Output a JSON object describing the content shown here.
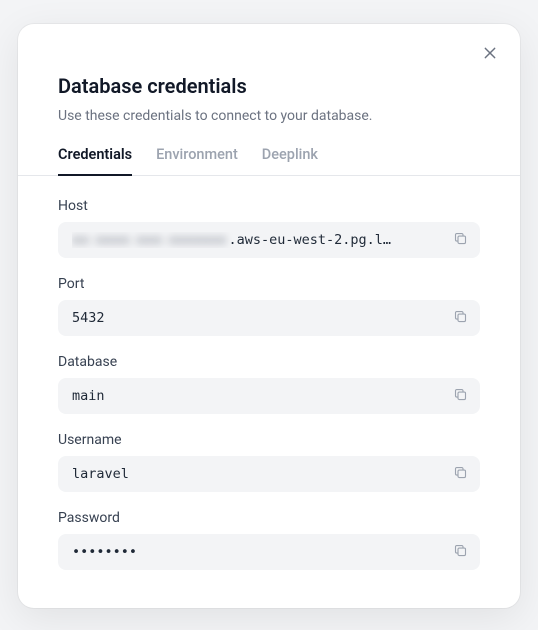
{
  "modal": {
    "title": "Database credentials",
    "subtitle": "Use these credentials to connect to your database."
  },
  "tabs": {
    "credentials": "Credentials",
    "environment": "Environment",
    "deeplink": "Deeplink"
  },
  "fields": {
    "host": {
      "label": "Host",
      "value_obscured": "xx-xxxx-xxx-xxxxxxx",
      "value_visible": ".aws-eu-west-2.pg.l…"
    },
    "port": {
      "label": "Port",
      "value": "5432"
    },
    "database": {
      "label": "Database",
      "value": "main"
    },
    "username": {
      "label": "Username",
      "value": "laravel"
    },
    "password": {
      "label": "Password",
      "value": "••••••••"
    }
  }
}
